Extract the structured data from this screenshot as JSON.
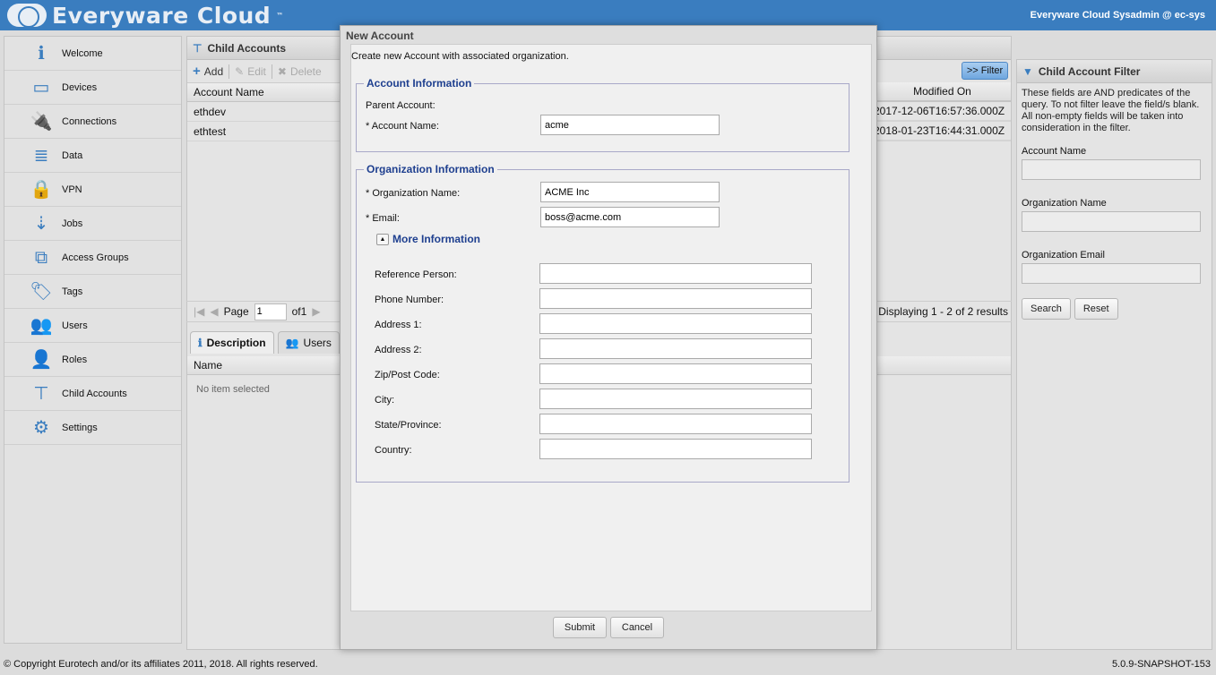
{
  "header": {
    "logo_text": "Everyware Cloud",
    "trademark": "™",
    "user": "Everyware Cloud Sysadmin @ ec-sys"
  },
  "sidebar": {
    "items": [
      {
        "label": "Welcome",
        "icon": "info-icon",
        "glyph": "ℹ"
      },
      {
        "label": "Devices",
        "icon": "device-icon",
        "glyph": "▭"
      },
      {
        "label": "Connections",
        "icon": "plug-icon",
        "glyph": "🔌"
      },
      {
        "label": "Data",
        "icon": "database-icon",
        "glyph": "≣"
      },
      {
        "label": "VPN",
        "icon": "lock-icon",
        "glyph": "🔒"
      },
      {
        "label": "Jobs",
        "icon": "jobs-icon",
        "glyph": "⇣"
      },
      {
        "label": "Access Groups",
        "icon": "access-groups-icon",
        "glyph": "⧉"
      },
      {
        "label": "Tags",
        "icon": "tag-icon",
        "glyph": "🏷"
      },
      {
        "label": "Users",
        "icon": "users-icon",
        "glyph": "👥"
      },
      {
        "label": "Roles",
        "icon": "role-icon",
        "glyph": "👤"
      },
      {
        "label": "Child Accounts",
        "icon": "sitemap-icon",
        "glyph": "⊤"
      },
      {
        "label": "Settings",
        "icon": "gear-icon",
        "glyph": "⚙"
      }
    ]
  },
  "center": {
    "title": "Child Accounts",
    "toolbar": {
      "add": "Add",
      "edit": "Edit",
      "delete": "Delete",
      "filter": ">> Filter"
    },
    "columns": {
      "name": "Account Name",
      "modified": "Modified On"
    },
    "rows": [
      {
        "name": "ethdev",
        "modified": "2017-12-06T16:57:36.000Z"
      },
      {
        "name": "ethtest",
        "modified": "2018-01-23T16:44:31.000Z"
      }
    ],
    "pager": {
      "page_label": "Page",
      "page": "1",
      "of": "of1",
      "display": "Displaying 1 - 2 of 2 results"
    },
    "tabs": [
      {
        "label": "Description"
      },
      {
        "label": "Users"
      }
    ],
    "detail": {
      "column": "Name",
      "empty": "No item selected"
    }
  },
  "filter": {
    "title": "Child Account Filter",
    "description": "These fields are AND predicates of the query. To not filter leave the field/s blank. All non-empty fields will be taken into consideration in the filter.",
    "fields": [
      {
        "label": "Account Name",
        "value": ""
      },
      {
        "label": "Organization Name",
        "value": ""
      },
      {
        "label": "Organization Email",
        "value": ""
      }
    ],
    "search": "Search",
    "reset": "Reset"
  },
  "dialog": {
    "title": "New Account",
    "intro": "Create new Account with associated organization.",
    "account_legend": "Account Information",
    "parent_label": "Parent Account:",
    "account_name_label": "* Account Name:",
    "account_name": "acme",
    "org_legend": "Organization Information",
    "org_name_label": "* Organization Name:",
    "org_name": "ACME Inc",
    "email_label": "* Email:",
    "email": "boss@acme.com",
    "more": "More Information",
    "more_fields": [
      {
        "label": "Reference Person:",
        "value": ""
      },
      {
        "label": "Phone Number:",
        "value": ""
      },
      {
        "label": "Address 1:",
        "value": ""
      },
      {
        "label": "Address 2:",
        "value": ""
      },
      {
        "label": "Zip/Post Code:",
        "value": ""
      },
      {
        "label": "City:",
        "value": ""
      },
      {
        "label": "State/Province:",
        "value": ""
      },
      {
        "label": "Country:",
        "value": ""
      }
    ],
    "submit": "Submit",
    "cancel": "Cancel"
  },
  "footer": {
    "copyright": "© Copyright Eurotech and/or its affiliates 2011, 2018. All rights reserved.",
    "version": "5.0.9-SNAPSHOT-153"
  },
  "colors": {
    "header": "#3a7dbf",
    "legend": "#1e3f8f",
    "accent": "#3a7dbf"
  }
}
